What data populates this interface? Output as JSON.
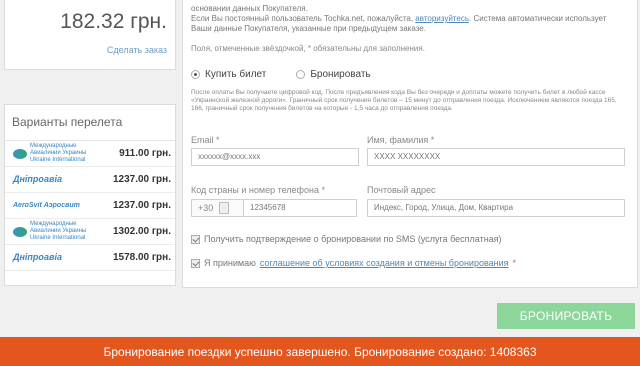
{
  "price_box": {
    "amount": "182.32 грн.",
    "change_link": "Сделать заказ"
  },
  "variants": {
    "title": "Варианты перелета",
    "items": [
      {
        "airline": "Международные Авиалинии Украины Ukraine International",
        "logo_style": "uia",
        "price": "911.00 грн."
      },
      {
        "airline": "Дніпроавіа",
        "logo_style": "dniproavia",
        "price": "1237.00 грн."
      },
      {
        "airline": "AeroSvit Аэросвит",
        "logo_style": "aerosvit",
        "price": "1237.00 грн."
      },
      {
        "airline": "Международные Авиалинии Украины Ukraine International",
        "logo_style": "uia",
        "price": "1302.00 грн."
      },
      {
        "airline": "Дніпроавіа",
        "logo_style": "dniproavia",
        "price": "1578.00 грн."
      }
    ]
  },
  "form": {
    "info_line1": "Если Вы постоянный пользователь Tochka.net, пожалуйста,",
    "info_link": "авторизуйтесь",
    "info_line1_tail": ". Система автоматически использует Ваши данные Покупателя, указанные при предыдущем заказе.",
    "info_prefix": "основании данных Покупателя.",
    "required_note": "Поля, отмеченные звёздочкой, * обязательны для заполнения.",
    "radio_buy": "Купить билет",
    "radio_book": "Бронировать",
    "notice": "После оплаты Вы получаете цифровой код. После предъявления кода Вы без очереди и доплаты можете получить билет в любой кассе «Украинской железной дороги». Граничный срок получения билетов – 15 минут до отправления поезда. Исключением являются поезда 165, 166, граничный срок получения билетов на которые - 1,5 часа до отправления поезда.",
    "email_label": "Email *",
    "email_value": "xxxxxx@xxxx.xxx",
    "name_label": "Имя, фамилия *",
    "name_value": "XXXX XXXXXXXX",
    "phone_label": "Код страны и номер телефона *",
    "phone_prefix": "+30",
    "phone_value": "12345678",
    "address_label": "Почтовый адрес",
    "address_placeholder": "Индекс, Город, Улица, Дом, Квартира",
    "sms_check_label": "Получить подтверждение о бронировании по SMS (услуга бесплатная)",
    "terms_prefix": "Я принимаю",
    "terms_link": "соглашение об условиях создания и отмены бронирования",
    "terms_star": "*"
  },
  "book_button": "БРОНИРОВАТЬ",
  "success_message": "Бронирование поездки успешно завершено. Бронирование создано: 1408363",
  "colors": {
    "success_bar": "#e3561e",
    "book_button": "#8cd69a",
    "link": "#4f87b8"
  }
}
